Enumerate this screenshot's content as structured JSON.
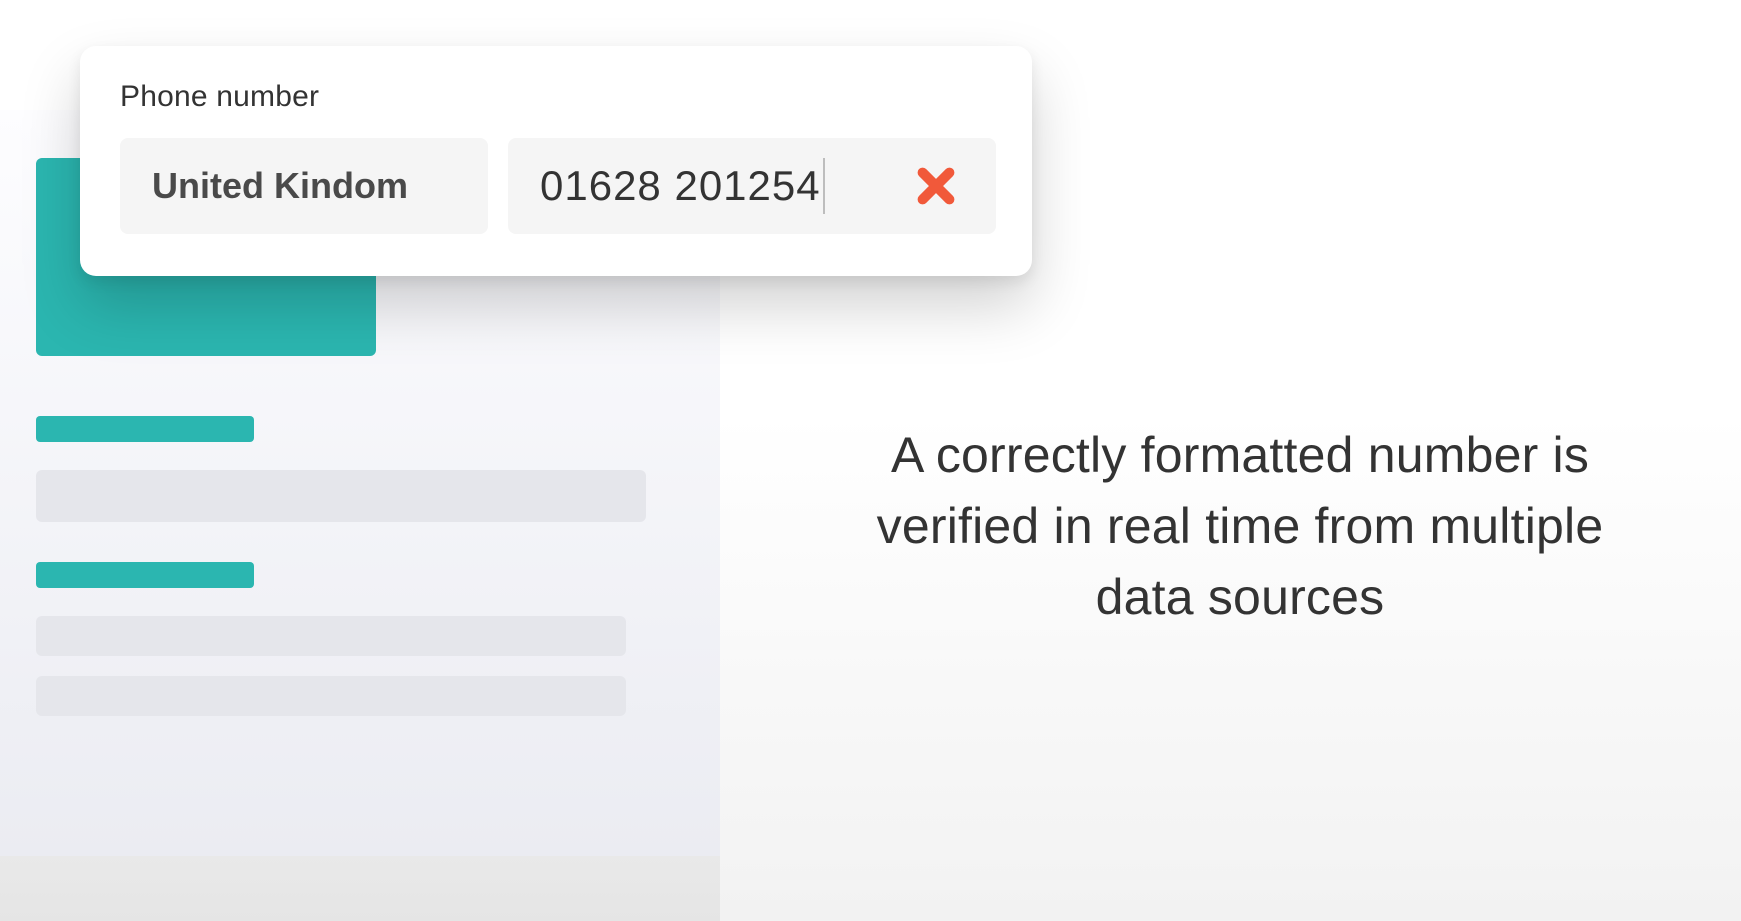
{
  "card": {
    "label": "Phone number",
    "country": "United Kindom",
    "phone": "01628 201254"
  },
  "caption": "A correctly formatted number is verified in real time from multiple data sources",
  "colors": {
    "teal": "#2bb6b0",
    "accent": "#f1593a"
  }
}
